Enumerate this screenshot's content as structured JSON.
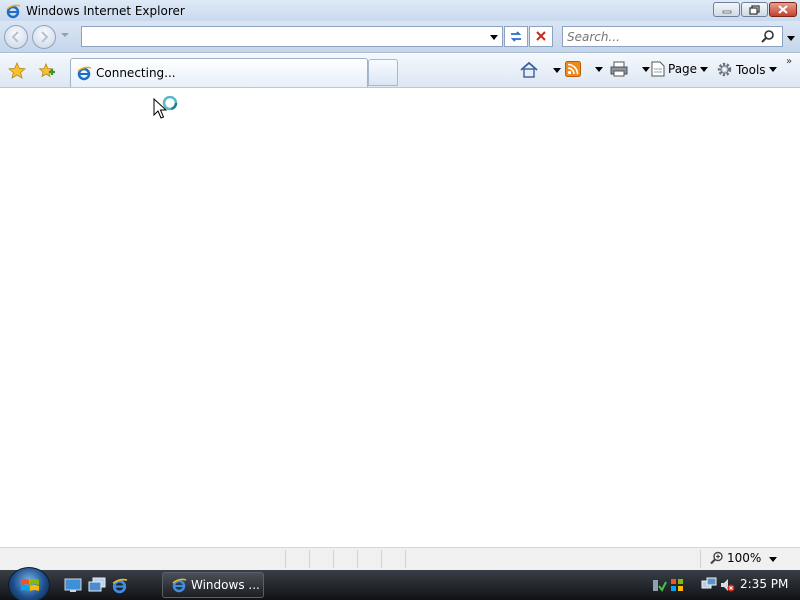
{
  "window": {
    "title": "Windows Internet Explorer"
  },
  "navigation": {
    "address_value": "",
    "search_placeholder": "Search..."
  },
  "tab": {
    "label": "Connecting..."
  },
  "commands": {
    "page_label": "Page",
    "tools_label": "Tools"
  },
  "statusbar": {
    "zoom_label": "100%"
  },
  "taskbar": {
    "task_label": "Windows ...",
    "clock": "2:35 PM"
  },
  "colors": {
    "title_bar": "#c9d9ee",
    "taskbar": "#1a1d22",
    "close_button": "#c4412c"
  },
  "icons": [
    "ie-icon",
    "back-icon",
    "forward-icon",
    "refresh-icon",
    "stop-icon",
    "search-icon",
    "favorites-star-icon",
    "add-favorites-icon",
    "home-icon",
    "rss-feed-icon",
    "print-icon",
    "page-icon",
    "gear-icon",
    "zoom-icon",
    "busy-cursor-icon",
    "network-icon",
    "volume-muted-icon"
  ]
}
